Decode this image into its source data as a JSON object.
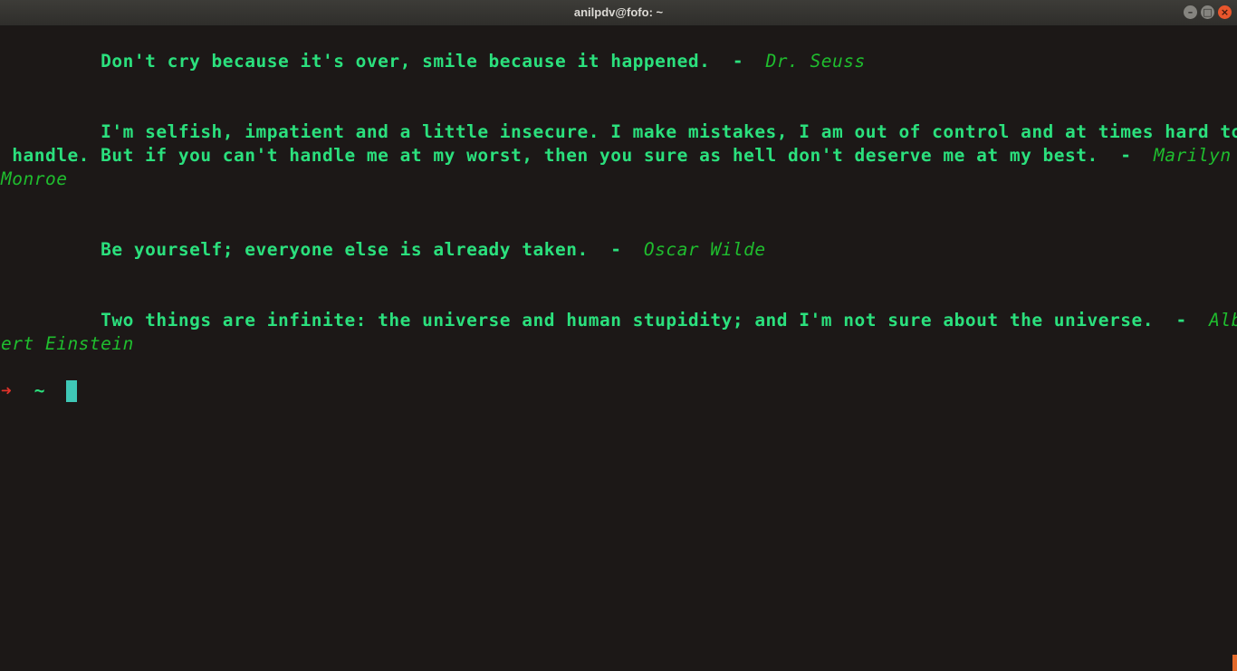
{
  "window": {
    "title": "anilpdv@fofo: ~"
  },
  "quotes": [
    {
      "lines": [
        "         Don't cry because it's over, smile because it happened.  -  "
      ],
      "author": "Dr. Seuss"
    },
    {
      "lines": [
        "         I'm selfish, impatient and a little insecure. I make mistakes, I am out of control and at times hard to",
        " handle. But if you can't handle me at my worst, then you sure as hell don't deserve me at my best.  -  "
      ],
      "author_line1": "Marilyn",
      "author_line2": "Monroe"
    },
    {
      "lines": [
        "         Be yourself; everyone else is already taken.  -  "
      ],
      "author": "Oscar Wilde"
    },
    {
      "lines": [
        "         Two things are infinite: the universe and human stupidity; and I'm not sure about the universe.  -  "
      ],
      "author_line1": "Alb",
      "author_line2": "ert Einstein"
    }
  ],
  "prompt": {
    "arrow": "➜",
    "dir": "~"
  }
}
